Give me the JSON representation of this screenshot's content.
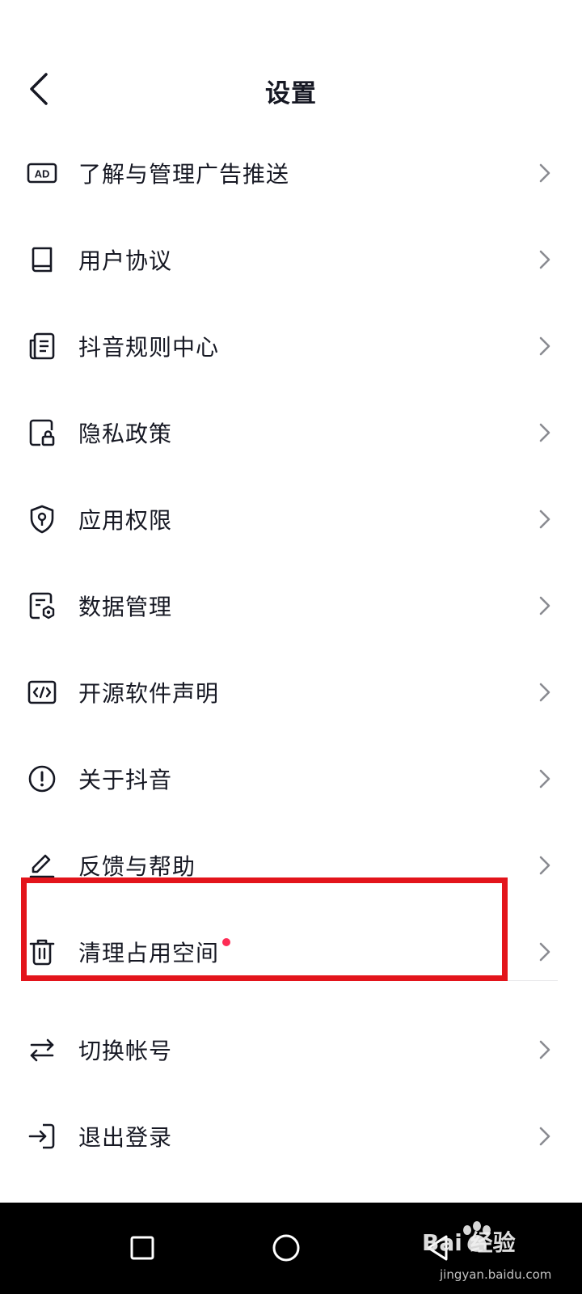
{
  "header": {
    "title": "设置"
  },
  "items": [
    {
      "label": "了解与管理广告推送",
      "icon": "ad-icon"
    },
    {
      "label": "用户协议",
      "icon": "book-icon"
    },
    {
      "label": "抖音规则中心",
      "icon": "document-list-icon"
    },
    {
      "label": "隐私政策",
      "icon": "lock-document-icon"
    },
    {
      "label": "应用权限",
      "icon": "shield-key-icon"
    },
    {
      "label": "数据管理",
      "icon": "document-gear-icon"
    },
    {
      "label": "开源软件声明",
      "icon": "code-icon"
    },
    {
      "label": "关于抖音",
      "icon": "info-circle-icon"
    },
    {
      "label": "反馈与帮助",
      "icon": "pencil-icon"
    },
    {
      "label": "清理占用空间",
      "icon": "trash-icon",
      "badge": "red-dot"
    },
    {
      "label": "切换帐号",
      "icon": "switch-arrows-icon"
    },
    {
      "label": "退出登录",
      "icon": "logout-icon"
    }
  ],
  "colors": {
    "badge": "#fe2c55",
    "highlight_box": "#e3141b",
    "text": "#161823",
    "chevron": "#8a8b91"
  },
  "watermark": {
    "logo": "Bai 经验",
    "sub": "jingyan.baidu.com"
  }
}
